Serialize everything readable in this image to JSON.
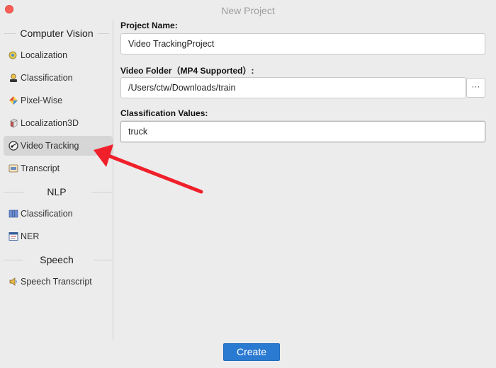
{
  "window": {
    "title": "New Project"
  },
  "sidebar": {
    "sections": [
      {
        "title": "Computer Vision",
        "items": [
          {
            "label": "Localization",
            "icon": "localization-icon"
          },
          {
            "label": "Classification",
            "icon": "classification-icon"
          },
          {
            "label": "Pixel-Wise",
            "icon": "pixel-wise-icon"
          },
          {
            "label": "Localization3D",
            "icon": "localization3d-icon"
          },
          {
            "label": "Video Tracking",
            "icon": "video-tracking-icon",
            "selected": true
          },
          {
            "label": "Transcript",
            "icon": "transcript-icon"
          }
        ]
      },
      {
        "title": "NLP",
        "items": [
          {
            "label": "Classification",
            "icon": "text-classification-icon"
          },
          {
            "label": "NER",
            "icon": "ner-icon"
          }
        ]
      },
      {
        "title": "Speech",
        "items": [
          {
            "label": "Speech Transcript",
            "icon": "speech-transcript-icon"
          }
        ]
      }
    ]
  },
  "form": {
    "project_name_label": "Project Name:",
    "project_name_value": "Video TrackingProject",
    "video_folder_label": "Video Folder（MP4 Supported）:",
    "video_folder_value": "/Users/ctw/Downloads/train",
    "browse_label": "···",
    "classification_label": "Classification Values:",
    "classification_value": "truck"
  },
  "footer": {
    "create_label": "Create"
  },
  "colors": {
    "accent": "#2a7ad2",
    "close": "#fc5e57",
    "selected_bg": "#d6d6d6",
    "annotation_arrow": "#f0202a"
  }
}
